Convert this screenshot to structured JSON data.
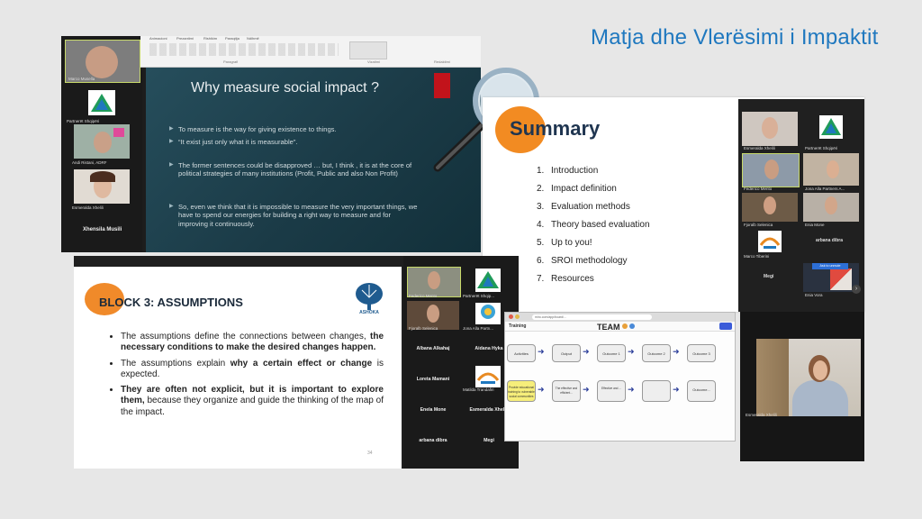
{
  "page_title": "Matja dhe Vlerësimi i Impaktit",
  "screenshot1": {
    "slide_title": "Why measure social impact ?",
    "bullets": [
      "To measure is the way for giving existence to things.",
      "“It exist just only what it is measurable”.",
      "The former sentences could be disapproved … but, I think , it is at the core of political strategies of many institutions (Profit, Public and also Non Profit)",
      "So, even we think that it is impossible to measure the very important things, we have to spend our energies for building a right way to measure and for improving it continuously."
    ],
    "participants": [
      "Marco Musella",
      "Partnerët Shqipëri",
      "Andi Ristani, ADRF",
      "Esmeralda Xhelili",
      "Xhensila Musili"
    ],
    "ribbon_tabs": [
      "Animacioni",
      "Prezantimi",
      "Rishikim",
      "Paraqitja",
      "Ndihmë"
    ],
    "ribbon_groups": [
      "Paragrafi",
      "Vizatimi",
      "Redaktimi"
    ]
  },
  "screenshot2": {
    "slide_title": "Summary",
    "items": [
      {
        "num": "1.",
        "label": "Introduction"
      },
      {
        "num": "2.",
        "label": "Impact definition"
      },
      {
        "num": "3.",
        "label": "Evaluation methods"
      },
      {
        "num": "4.",
        "label": "Theory based evaluation"
      },
      {
        "num": "5.",
        "label": "Up to you!"
      },
      {
        "num": "6.",
        "label": "SROI methodology"
      },
      {
        "num": "7.",
        "label": "Resources"
      }
    ],
    "participants": [
      "Esmeralda Xhelili",
      "Partnerët Shqipëri",
      "Federico Mento",
      "Jona Alla Partners A...",
      "Fjoralb Selenica",
      "Enia Mone",
      "Marco Tiberini",
      "arbana dibra",
      "Megi",
      "Enia Vora"
    ],
    "ask_button": "Ask to unmute"
  },
  "screenshot3": {
    "slide_title": "BLOCK 3: ASSUMPTIONS",
    "logo_label": "ASHOKA",
    "page_number": "34",
    "points": [
      {
        "normal": "The assumptions define the connections between changes, ",
        "bold": "the necessary conditions to make the desired changes happen."
      },
      {
        "normal": "The assumptions explain ",
        "bold": "why a certain effect or change",
        "after": " is expected."
      },
      {
        "bold": "They are often not explicit, but it is important to explore them,",
        "after": " because they organize and guide the thinking of the map of the impact."
      }
    ],
    "participants": [
      "Federico Mento",
      "Partnerët Shqip...",
      "Fjoralb Selenica",
      "Jona Alla Partn...",
      "Albana Alkahaj",
      "Aidana Hyka",
      "Loreta Mamani",
      "Matilda Trandafiri",
      "Enela Mone",
      "Esmeralda Xhelili",
      "arbana dibra",
      "Megi"
    ]
  },
  "screenshot4": {
    "url": "miro.com/app/board/...",
    "board_title": "TEAM",
    "board_name": "Training",
    "row1": [
      "Activities",
      "Output",
      "Outcome 1",
      "Outcome 2",
      "Outcome 3"
    ],
    "row2": [
      "Provide educational training to vulnerable social communities",
      "The effective and efficient...",
      "Effective and ...",
      "",
      "Outcome..."
    ]
  },
  "screenshot5": {
    "name": "Esmeralda Xhelili"
  }
}
